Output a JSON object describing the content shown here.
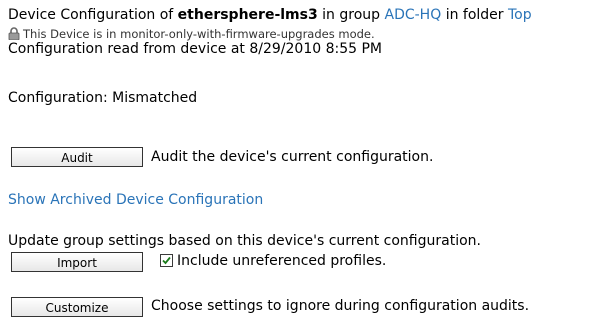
{
  "header": {
    "prefix": "Device Configuration of",
    "device_name": "ethersphere-lms3",
    "in_group": "in group",
    "group_link": "ADC-HQ",
    "in_folder": "in folder",
    "folder_link": "Top"
  },
  "mode_notice": "This Device is in monitor-only-with-firmware-upgrades mode.",
  "read_from_device": "Configuration read from device at 8/29/2010 8:55 PM",
  "configuration_status": "Configuration: Mismatched",
  "audit": {
    "button_label": "Audit",
    "description": "Audit the device's current configuration."
  },
  "archived_link": "Show Archived Device Configuration",
  "import": {
    "intro": "Update group settings based on this device's current configuration.",
    "button_label": "Import",
    "checkbox_label": "Include unreferenced profiles.",
    "checkbox_checked": true
  },
  "customize": {
    "button_label": "Customize",
    "description": "Choose settings to ignore during configuration audits."
  }
}
